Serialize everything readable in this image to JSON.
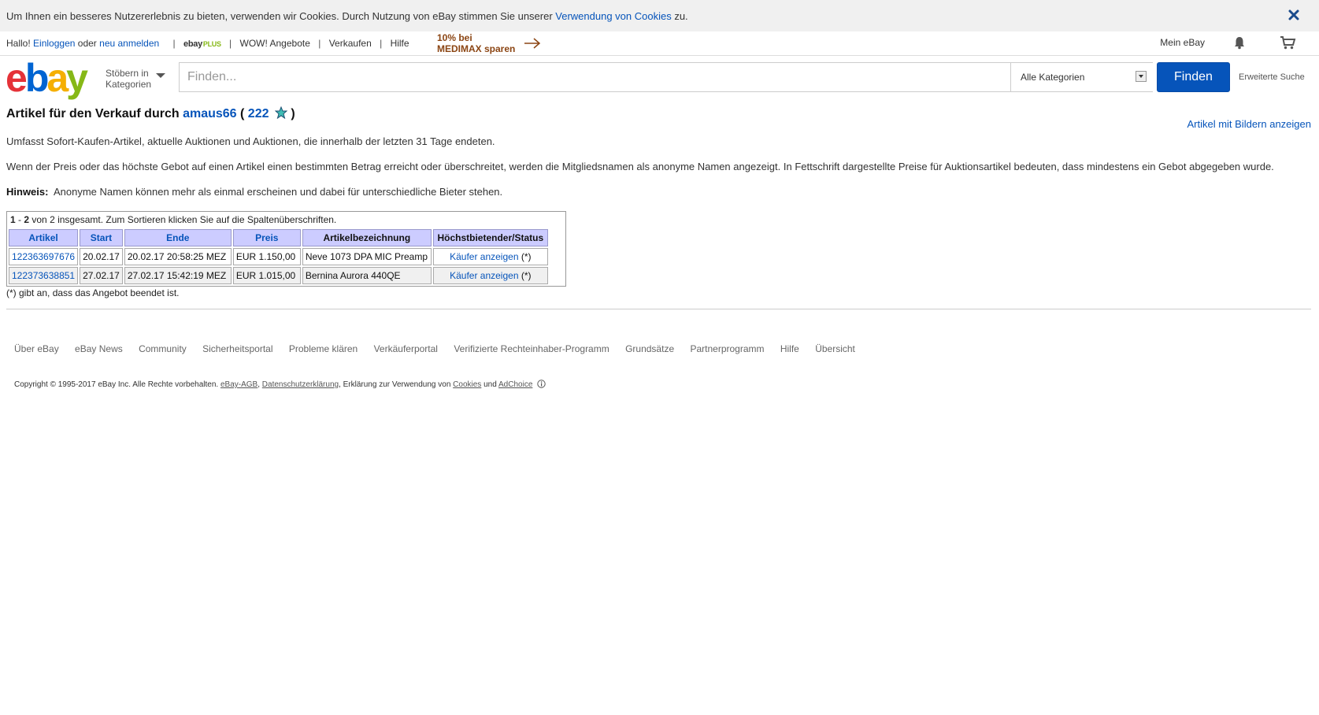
{
  "cookie_bar": {
    "text_before": "Um Ihnen ein besseres Nutzererlebnis zu bieten, verwenden wir Cookies. Durch Nutzung von eBay stimmen Sie unserer ",
    "link": "Verwendung von Cookies",
    "text_after": " zu."
  },
  "topnav": {
    "hello": "Hallo!",
    "login": "Einloggen",
    "or": "oder",
    "register": "neu anmelden",
    "ebay_plus_prefix": "ebay",
    "ebay_plus_suffix": "PLUS",
    "wow": "WOW! Angebote",
    "sell": "Verkaufen",
    "help": "Hilfe",
    "promo_line1": "10% bei",
    "promo_line2": "MEDIMAX sparen",
    "my_ebay": "Mein eBay"
  },
  "header": {
    "browse_line1": "Stöbern in",
    "browse_line2": "Kategorien",
    "search_placeholder": "Finden...",
    "category": "Alle Kategorien",
    "search_button": "Finden",
    "advanced_search": "Erweiterte Suche"
  },
  "main": {
    "title_prefix": "Artikel für den Verkauf durch",
    "seller": "amaus66",
    "open_paren": "(",
    "feedback_score": "222",
    "close_paren": ")",
    "view_with_pictures": "Artikel mit Bildern anzeigen",
    "para1": "Umfasst Sofort-Kaufen-Artikel, aktuelle Auktionen und Auktionen, die innerhalb der letzten 31 Tage endeten.",
    "para2": "Wenn der Preis oder das höchste Gebot auf einen Artikel einen bestimmten Betrag erreicht oder überschreitet, werden die Mitgliedsnamen als anonyme Namen angezeigt. In Fettschrift dargestellte Preise für Auktionsartikel bedeuten, dass mindestens ein Gebot abgegeben wurde.",
    "hint_label": "Hinweis:",
    "hint_text": "Anonyme Namen können mehr als einmal erscheinen und dabei für unterschiedliche Bieter stehen.",
    "summary_from": "1",
    "summary_dash": " - ",
    "summary_to": "2",
    "summary_rest": " von 2 insgesamt. Zum Sortieren klicken Sie auf die Spaltenüberschriften.",
    "columns": [
      "Artikel",
      "Start",
      "Ende",
      "Preis",
      "Artikelbezeichnung",
      "Höchstbietender/Status"
    ],
    "rows": [
      {
        "item": "122363697676",
        "start": "20.02.17",
        "end": "20.02.17 20:58:25 MEZ",
        "price": "EUR 1.150,00",
        "title": "Neve 1073 DPA MIC Preamp",
        "buyer_link": "Käufer anzeigen",
        "status": "(*)"
      },
      {
        "item": "122373638851",
        "start": "27.02.17",
        "end": "27.02.17 15:42:19 MEZ",
        "price": "EUR 1.015,00",
        "title": "Bernina Aurora 440QE",
        "buyer_link": "Käufer anzeigen",
        "status": "(*)"
      }
    ],
    "footnote": "(*) gibt an, dass das Angebot beendet ist."
  },
  "footer": {
    "links": [
      "Über eBay",
      "eBay News",
      "Community",
      "Sicherheitsportal",
      "Probleme klären",
      "Verkäuferportal",
      "Verifizierte Rechteinhaber-Programm",
      "Grundsätze",
      "Partnerprogramm",
      "Hilfe",
      "Übersicht"
    ],
    "copyright": "Copyright © 1995-2017 eBay Inc. Alle Rechte vorbehalten.",
    "agb": "eBay-AGB",
    "comma1": ", ",
    "privacy": "Datenschutzerklärung",
    "cookies_prefix": ", Erklärung zur Verwendung von ",
    "cookies": "Cookies",
    "and": " und ",
    "adchoice": "AdChoice"
  },
  "colors": {
    "accent": "#0654ba",
    "header_bg": "#ccccff"
  },
  "icons": [
    "close-icon",
    "bell-icon",
    "cart-icon",
    "star-icon",
    "chevron-down-icon",
    "adchoice-icon"
  ]
}
